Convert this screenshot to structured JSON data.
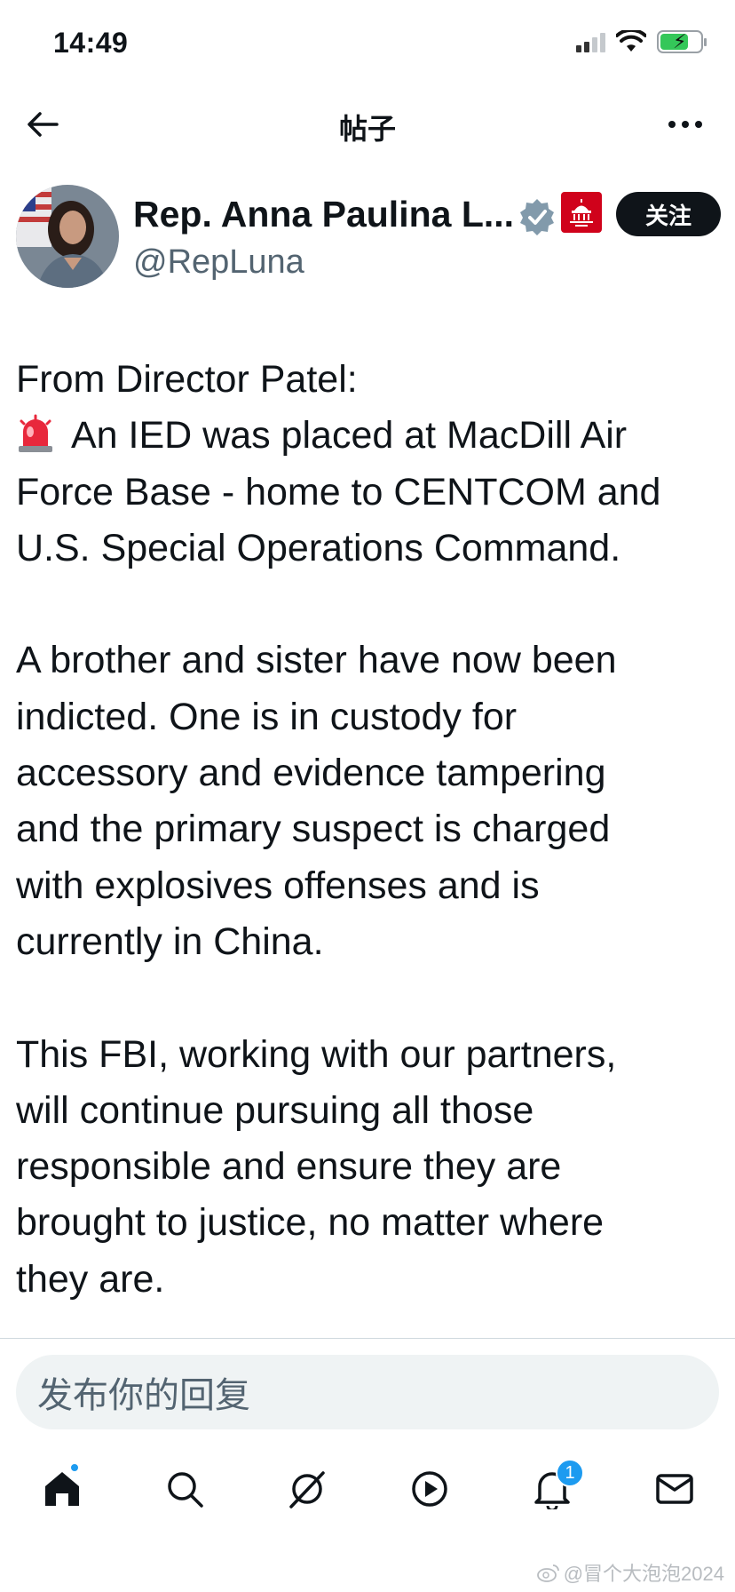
{
  "status_bar": {
    "time": "14:49",
    "icons": [
      "cellular-signal-icon",
      "wifi-icon",
      "battery-charging-icon"
    ]
  },
  "header": {
    "title": "帖子",
    "back_icon": "arrow-left-icon",
    "more_icon": "more-horizontal-icon"
  },
  "author": {
    "name": "Rep. Anna Paulina L...",
    "handle": "@RepLuna",
    "follow_label": "关注",
    "badges": [
      "verified-badge-icon",
      "congress-gop-badge-icon"
    ]
  },
  "post": {
    "paragraphs": [
      [
        "From Director Patel:",
        "An IED was placed at MacDill Air",
        "Force Base - home to CENTCOM and",
        "U.S. Special Operations Command."
      ],
      [
        "A brother and sister have now been",
        "indicted. One is in custody for",
        "accessory and evidence tampering",
        "and the primary suspect is charged",
        "with explosives offenses and is",
        "currently in China."
      ],
      [
        "This FBI, working with our partners,",
        "will continue pursuing all those",
        "responsible and ensure they are",
        "brought to justice, no matter where",
        "they are."
      ]
    ],
    "emoji": "police-siren-icon"
  },
  "reply": {
    "placeholder": "发布你的回复"
  },
  "tab_bar": {
    "tabs": [
      "home-icon",
      "search-icon",
      "grok-icon",
      "video-play-icon",
      "notifications-bell-icon",
      "messages-envelope-icon"
    ],
    "notification_count": "1"
  },
  "watermark": "@冒个大泡泡2024",
  "colors": {
    "text": "#0f1419",
    "secondary": "#536471",
    "accent": "#1d9bf0",
    "verified": "#829aab",
    "congress_red": "#d0021b"
  }
}
